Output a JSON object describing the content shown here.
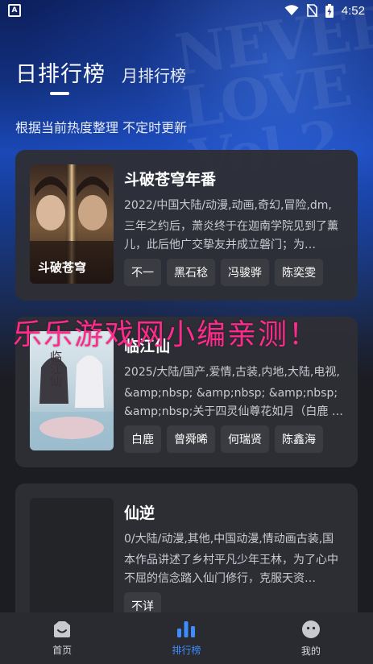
{
  "status_bar": {
    "time": "4:52",
    "notification_letter": "A"
  },
  "hero_watermark": "NEVER LOVE Vol 2",
  "tabs": {
    "day": "日排行榜",
    "month": "月排行榜"
  },
  "subtitle": "根据当前热度整理 不定时更新",
  "overlay_watermark": "乐乐游戏网小编亲测！",
  "cards": [
    {
      "title": "斗破苍穹年番",
      "meta": "2022/中国大陆/动漫,动画,奇幻,冒险,dm,",
      "desc": "三年之约后，萧炎终于在迦南学院见到了薰儿，此后他广交挚友并成立磐门；为…",
      "poster_caption": "斗破苍穹",
      "tags": [
        "不一",
        "黑石稔",
        "冯骏骅",
        "陈奕雯"
      ]
    },
    {
      "title": "临江仙",
      "meta": "2025/大陆/国产,爱情,古装,内地,大陆,电视,",
      "desc": "&amp;nbsp; &amp;nbsp; &amp;nbsp; &amp;nbsp;关于四灵仙尊花如月（白鹿 …",
      "poster_caption": "临江仙",
      "tags": [
        "白鹿",
        "曾舜晞",
        "何瑞贤",
        "陈鑫海"
      ]
    },
    {
      "title": "仙逆",
      "meta": "0/大陆/动漫,其他,中国动漫,情动画古装,国",
      "desc": "本作品讲述了乡村平凡少年王林，为了心中不屈的信念踏入仙门修行，克服天资…",
      "poster_caption": "",
      "tags": [
        "不详"
      ]
    }
  ],
  "bottom_nav": [
    {
      "label": "首页",
      "icon": "home-face-icon"
    },
    {
      "label": "排行榜",
      "icon": "bar-chart-icon"
    },
    {
      "label": "我的",
      "icon": "profile-face-icon"
    }
  ],
  "colors": {
    "accent": "#3f8cff",
    "watermark": "#ff2a8c",
    "card_bg": "#2e2f35"
  }
}
